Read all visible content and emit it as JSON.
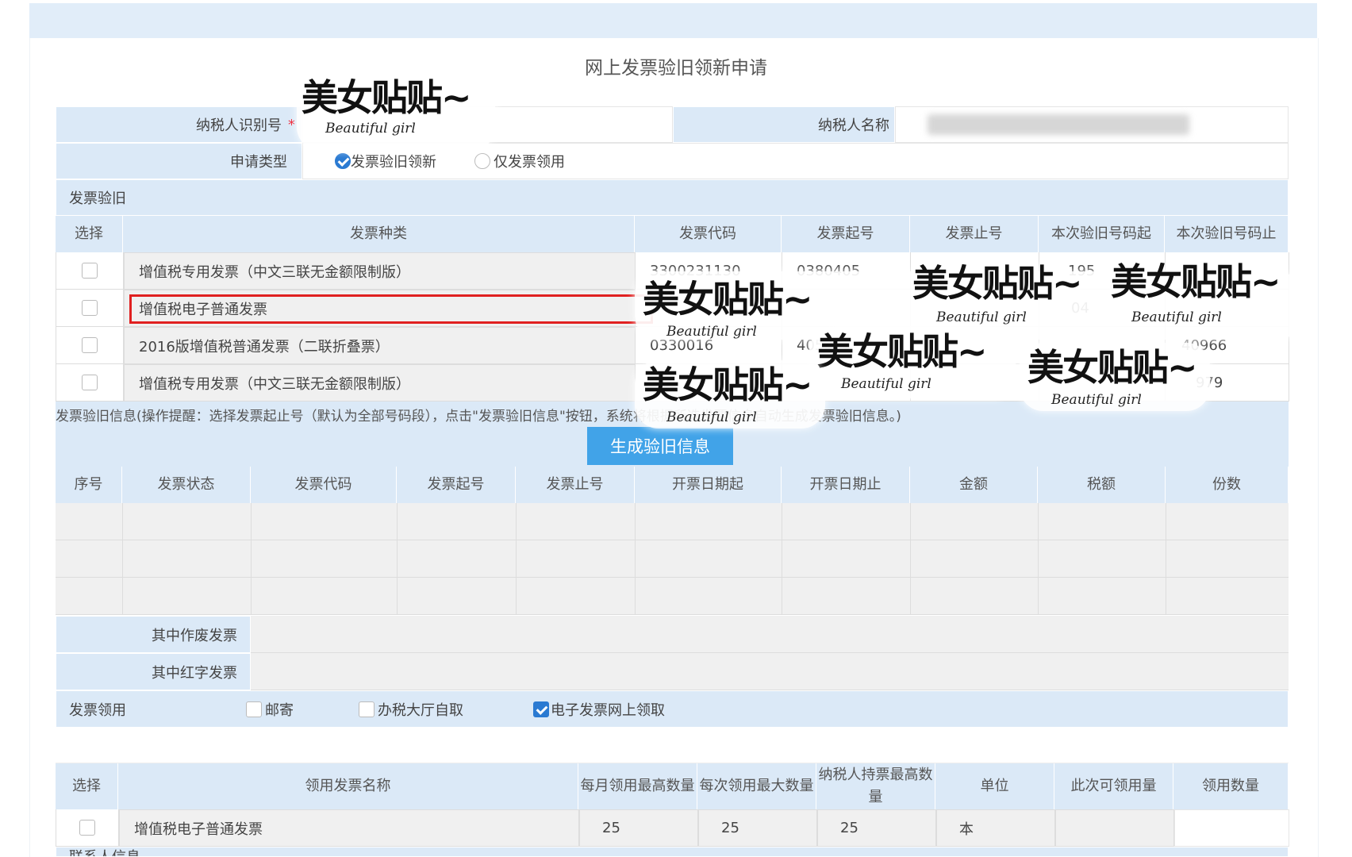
{
  "page_title": "网上发票验旧领新申请",
  "taxpayer": {
    "id_label": "纳税人识别号",
    "required_mark": "*",
    "name_label": "纳税人名称",
    "apply_type_label": "申请类型",
    "apply_options": [
      "发票验旧领新",
      "仅发票领用"
    ]
  },
  "verify_section": {
    "title": "发票验旧",
    "headers": [
      "选择",
      "发票种类",
      "发票代码",
      "发票起号",
      "发票止号",
      "本次验旧号码起",
      "本次验旧号码止"
    ],
    "rows": [
      {
        "type": "增值税专用发票（中文三联无金额限制版）",
        "code": "3300231130",
        "start": "0380405",
        "end": "",
        "vstart": "195",
        "vend": ""
      },
      {
        "type": "增值税电子普通发票",
        "code": "",
        "start": "",
        "end": "",
        "vstart": "04",
        "vend": ""
      },
      {
        "type": "2016版增值税普通发票（二联折叠票）",
        "code": "0330016",
        "start": "405",
        "end": "",
        "vstart": "",
        "vend": "40966"
      },
      {
        "type": "增值税专用发票（中文三联无金额限制版）",
        "code": "",
        "start": "",
        "end": "",
        "vstart": "",
        "vend": "979"
      }
    ]
  },
  "info_hint": "发票验旧信息(操作提醒：选择发票起止号（默认为全部号码段），点击\"发票验旧信息\"按钮，系统将根据所选发票信息自动生成发票验旧信息。)",
  "generate_button": "生成验旧信息",
  "result_table": {
    "headers": [
      "序号",
      "发票状态",
      "发票代码",
      "发票起号",
      "发票止号",
      "开票日期起",
      "开票日期止",
      "金额",
      "税额",
      "份数"
    ],
    "void_label": "其中作废发票",
    "red_label": "其中红字发票"
  },
  "receive": {
    "label": "发票领用",
    "options": [
      {
        "label": "邮寄",
        "checked": false
      },
      {
        "label": "办税大厅自取",
        "checked": false
      },
      {
        "label": "电子发票网上领取",
        "checked": true
      }
    ]
  },
  "receive_table": {
    "headers": [
      "选择",
      "领用发票名称",
      "每月领用最高数量",
      "每次领用最大数量",
      "纳税人持票最高数量",
      "单位",
      "此次可领用量",
      "领用数量"
    ],
    "rows": [
      {
        "name": "增值税电子普通发票",
        "monthly_max": "25",
        "each_max": "25",
        "hold_max": "25",
        "unit": "本",
        "available": "",
        "quantity": ""
      }
    ]
  },
  "contact_title": "联系人信息",
  "sticker": {
    "main": "美女贴贴~",
    "sub": "Beautiful girl"
  }
}
